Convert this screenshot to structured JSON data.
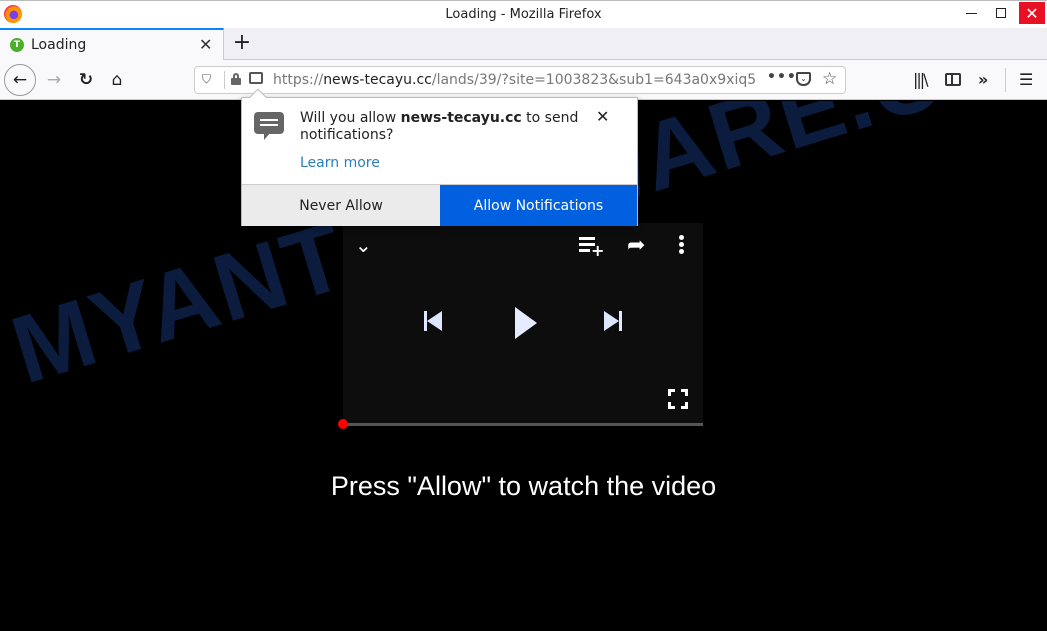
{
  "window": {
    "title": "Loading - Mozilla Firefox",
    "minimize_icon": "minimize-icon",
    "maximize_icon": "maximize-icon",
    "close_glyph": "✕"
  },
  "tabs": [
    {
      "label": "Loading",
      "favicon_letter": "T",
      "close_glyph": "✕",
      "active": true
    }
  ],
  "new_tab_glyph": "+",
  "nav": {
    "back_glyph": "←",
    "forward_glyph": "→",
    "reload_glyph": "↻",
    "home_glyph": "⌂"
  },
  "urlbar": {
    "scheme": "https://",
    "host": "news-tecayu.cc",
    "path": "/lands/39/?site=1003823&sub1=643a0x9xiq5",
    "shield_glyph": "⛉",
    "page_actions_glyph": "•••",
    "pocket_glyph": "⌄",
    "bookmark_glyph": "☆"
  },
  "toolbar": {
    "library_glyph": "|||\\",
    "overflow_glyph": "»",
    "menu_glyph": "☰"
  },
  "notification_popup": {
    "message_prefix": "Will you allow ",
    "message_host": "news-tecayu.cc",
    "message_suffix": " to send notifications?",
    "learn_more": "Learn more",
    "close_glyph": "✕",
    "never_allow": "Never Allow",
    "allow": "Allow Notifications",
    "allow_color": "#0060df"
  },
  "player": {
    "chevron_glyph": "⌄",
    "share_glyph": "➦",
    "plus_glyph": "+",
    "progress_fraction": 0.0
  },
  "page": {
    "cta_text": "Press \"Allow\" to watch the video",
    "watermark": "MYANTISPYWARE.COM"
  }
}
